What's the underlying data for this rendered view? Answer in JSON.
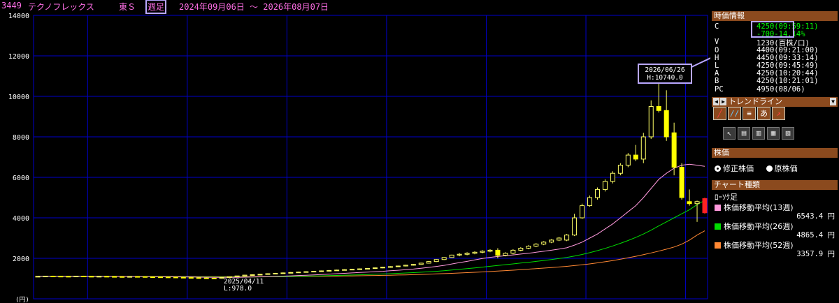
{
  "header": {
    "code": "3449",
    "name": "テクノフレックス",
    "market": "東Ｓ",
    "period": "週足",
    "range": "2024年09月06日 ～ 2026年08月07日"
  },
  "panel": {
    "price_info_title": "時価情報",
    "rows": [
      {
        "label": "C",
        "value": "4250",
        "extra": "(09:59:11)"
      },
      {
        "label": "",
        "value": "-700",
        "extra": "-14.14%"
      },
      {
        "label": "V",
        "value": "1230",
        "extra": "(百株/口)"
      },
      {
        "label": "O",
        "value": "4400",
        "extra": "(09:21:00)"
      },
      {
        "label": "H",
        "value": "4450",
        "extra": "(09:33:14)"
      },
      {
        "label": "L",
        "value": "4250",
        "extra": "(09:45:49)"
      },
      {
        "label": "A",
        "value": "4250",
        "extra": "(10:20:44)"
      },
      {
        "label": "B",
        "value": "4250",
        "extra": "(10:21:01)"
      },
      {
        "label": "PC",
        "value": "4950",
        "extra": "(08/06)"
      }
    ],
    "trendline_title": "トレンドライン",
    "stock_price_title": "株価",
    "radio_adjusted": "修正株価",
    "radio_original": "原株価",
    "chart_type_title": "チャート種類",
    "chart_type_value": "ﾛｰｿｸ足",
    "legend": [
      {
        "label": "株価移動平均(13週)",
        "value": "6543.4 円",
        "color": "#ff99dd"
      },
      {
        "label": "株価移動平均(26週)",
        "value": "4865.4 円",
        "color": "#00dd00"
      },
      {
        "label": "株価移動平均(52週)",
        "value": "3357.9 円",
        "color": "#ff8833"
      }
    ]
  },
  "chart_data": {
    "type": "candlestick",
    "ylim": [
      0,
      14000
    ],
    "yticks": [
      "0",
      "2000",
      "4000",
      "6000",
      "8000",
      "10000",
      "12000",
      "14000"
    ],
    "y_unit_label": "(円)",
    "colors": {
      "up": "#ffff00",
      "down_big": "#ffff00",
      "latest_down": "#ff2222",
      "grid": "#0000cc",
      "ma13": "#ff99dd",
      "ma26": "#00dd00",
      "ma52": "#ff8833"
    },
    "annotations": [
      {
        "date": "2026/06/26",
        "text": "H:10740.0",
        "value": 10740
      },
      {
        "date": "2025/04/11",
        "text": "L:978.0",
        "value": 978
      }
    ],
    "candles": [
      [
        1100,
        1120,
        1080,
        1110
      ],
      [
        1110,
        1130,
        1090,
        1120
      ],
      [
        1120,
        1140,
        1100,
        1115
      ],
      [
        1115,
        1130,
        1095,
        1110
      ],
      [
        1110,
        1125,
        1090,
        1105
      ],
      [
        1105,
        1130,
        1090,
        1120
      ],
      [
        1120,
        1140,
        1100,
        1110
      ],
      [
        1110,
        1120,
        1085,
        1100
      ],
      [
        1100,
        1120,
        1080,
        1110
      ],
      [
        1110,
        1130,
        1090,
        1100
      ],
      [
        1100,
        1115,
        1080,
        1095
      ],
      [
        1095,
        1110,
        1070,
        1090
      ],
      [
        1090,
        1110,
        1070,
        1100
      ],
      [
        1100,
        1120,
        1080,
        1095
      ],
      [
        1095,
        1110,
        1070,
        1085
      ],
      [
        1085,
        1100,
        1060,
        1080
      ],
      [
        1080,
        1100,
        1050,
        1075
      ],
      [
        1075,
        1090,
        1040,
        1070
      ],
      [
        1070,
        1085,
        1030,
        1060
      ],
      [
        1060,
        1080,
        1020,
        1050
      ],
      [
        1050,
        1070,
        1010,
        1040
      ],
      [
        1040,
        1060,
        1000,
        1030
      ],
      [
        1030,
        1050,
        990,
        1020
      ],
      [
        1020,
        1040,
        978,
        1010
      ],
      [
        1010,
        1060,
        990,
        1050
      ],
      [
        1050,
        1100,
        1030,
        1090
      ],
      [
        1090,
        1140,
        1070,
        1130
      ],
      [
        1130,
        1180,
        1110,
        1170
      ],
      [
        1170,
        1210,
        1150,
        1190
      ],
      [
        1190,
        1230,
        1170,
        1210
      ],
      [
        1210,
        1260,
        1190,
        1240
      ],
      [
        1240,
        1280,
        1220,
        1260
      ],
      [
        1260,
        1300,
        1240,
        1280
      ],
      [
        1280,
        1320,
        1260,
        1300
      ],
      [
        1300,
        1340,
        1280,
        1320
      ],
      [
        1320,
        1360,
        1300,
        1340
      ],
      [
        1340,
        1380,
        1320,
        1360
      ],
      [
        1360,
        1400,
        1340,
        1380
      ],
      [
        1380,
        1420,
        1360,
        1400
      ],
      [
        1400,
        1440,
        1380,
        1420
      ],
      [
        1420,
        1460,
        1400,
        1440
      ],
      [
        1440,
        1480,
        1420,
        1460
      ],
      [
        1460,
        1500,
        1440,
        1480
      ],
      [
        1480,
        1520,
        1460,
        1500
      ],
      [
        1500,
        1550,
        1480,
        1530
      ],
      [
        1530,
        1580,
        1510,
        1560
      ],
      [
        1560,
        1610,
        1540,
        1590
      ],
      [
        1590,
        1640,
        1570,
        1620
      ],
      [
        1620,
        1680,
        1600,
        1660
      ],
      [
        1660,
        1720,
        1640,
        1700
      ],
      [
        1700,
        1780,
        1680,
        1760
      ],
      [
        1760,
        1860,
        1740,
        1840
      ],
      [
        1840,
        1960,
        1820,
        1940
      ],
      [
        1940,
        2060,
        1920,
        2040
      ],
      [
        2040,
        2180,
        2020,
        2160
      ],
      [
        2160,
        2260,
        2100,
        2200
      ],
      [
        2200,
        2300,
        2150,
        2250
      ],
      [
        2250,
        2350,
        2200,
        2300
      ],
      [
        2300,
        2400,
        2250,
        2350
      ],
      [
        2350,
        2450,
        2300,
        2400
      ],
      [
        2400,
        2500,
        2000,
        2150
      ],
      [
        2150,
        2300,
        2100,
        2250
      ],
      [
        2250,
        2450,
        2200,
        2400
      ],
      [
        2400,
        2550,
        2350,
        2500
      ],
      [
        2500,
        2650,
        2450,
        2600
      ],
      [
        2600,
        2750,
        2550,
        2700
      ],
      [
        2700,
        2850,
        2650,
        2800
      ],
      [
        2800,
        2950,
        2750,
        2900
      ],
      [
        2900,
        3050,
        2850,
        3000
      ],
      [
        2900,
        3200,
        2850,
        3150
      ],
      [
        3150,
        4200,
        3100,
        4000
      ],
      [
        4000,
        4700,
        3950,
        4600
      ],
      [
        4600,
        5100,
        4550,
        5000
      ],
      [
        5000,
        5500,
        4900,
        5400
      ],
      [
        5400,
        5900,
        5300,
        5800
      ],
      [
        5800,
        6300,
        5700,
        6200
      ],
      [
        6200,
        6700,
        6100,
        6600
      ],
      [
        6600,
        7200,
        6500,
        7100
      ],
      [
        7100,
        7600,
        6800,
        6900
      ],
      [
        6900,
        8200,
        6700,
        8000
      ],
      [
        8000,
        9800,
        7900,
        9500
      ],
      [
        9500,
        10740,
        9200,
        9300
      ],
      [
        9300,
        10300,
        7800,
        8000
      ],
      [
        8200,
        8700,
        6100,
        6500
      ],
      [
        6500,
        6700,
        4900,
        5000
      ],
      [
        4800,
        5400,
        4600,
        4700
      ],
      [
        4700,
        4850,
        3800,
        4800
      ],
      [
        4950,
        5000,
        4200,
        4250
      ]
    ],
    "ma13": [
      1110,
      1110,
      1112,
      1112,
      1111,
      1110,
      1110,
      1108,
      1107,
      1106,
      1104,
      1102,
      1100,
      1099,
      1097,
      1094,
      1091,
      1088,
      1085,
      1080,
      1075,
      1070,
      1065,
      1060,
      1058,
      1058,
      1062,
      1068,
      1076,
      1085,
      1095,
      1108,
      1120,
      1135,
      1150,
      1165,
      1180,
      1200,
      1220,
      1240,
      1260,
      1280,
      1300,
      1320,
      1340,
      1360,
      1385,
      1410,
      1440,
      1470,
      1510,
      1550,
      1600,
      1650,
      1720,
      1790,
      1850,
      1920,
      1990,
      2050,
      2090,
      2130,
      2170,
      2210,
      2250,
      2300,
      2350,
      2400,
      2460,
      2520,
      2650,
      2800,
      3000,
      3200,
      3450,
      3700,
      4000,
      4300,
      4600,
      5000,
      5450,
      5900,
      6200,
      6450,
      6600,
      6650,
      6600,
      6543
    ],
    "ma26": [
      1110,
      1110,
      1110,
      1110,
      1110,
      1110,
      1110,
      1110,
      1110,
      1108,
      1106,
      1104,
      1102,
      1100,
      1098,
      1096,
      1094,
      1092,
      1090,
      1088,
      1086,
      1084,
      1082,
      1080,
      1078,
      1077,
      1077,
      1078,
      1080,
      1083,
      1087,
      1092,
      1098,
      1104,
      1110,
      1118,
      1126,
      1135,
      1145,
      1155,
      1165,
      1175,
      1187,
      1200,
      1213,
      1227,
      1242,
      1258,
      1275,
      1293,
      1313,
      1335,
      1360,
      1388,
      1420,
      1455,
      1490,
      1528,
      1566,
      1606,
      1645,
      1685,
      1725,
      1765,
      1805,
      1848,
      1893,
      1940,
      1990,
      2040,
      2110,
      2190,
      2280,
      2380,
      2490,
      2610,
      2740,
      2880,
      3030,
      3200,
      3390,
      3600,
      3800,
      4000,
      4200,
      4400,
      4650,
      4865
    ],
    "ma52": [
      1110,
      1110,
      1110,
      1110,
      1110,
      1110,
      1110,
      1110,
      1110,
      1110,
      1109,
      1108,
      1107,
      1106,
      1105,
      1104,
      1103,
      1102,
      1101,
      1100,
      1099,
      1098,
      1097,
      1096,
      1095,
      1094,
      1093,
      1093,
      1093,
      1094,
      1095,
      1097,
      1099,
      1101,
      1104,
      1107,
      1110,
      1114,
      1118,
      1122,
      1127,
      1132,
      1138,
      1144,
      1151,
      1158,
      1166,
      1175,
      1184,
      1194,
      1205,
      1217,
      1230,
      1244,
      1259,
      1275,
      1292,
      1310,
      1329,
      1349,
      1370,
      1392,
      1415,
      1439,
      1464,
      1490,
      1517,
      1545,
      1574,
      1604,
      1640,
      1680,
      1725,
      1775,
      1830,
      1890,
      1955,
      2025,
      2100,
      2180,
      2265,
      2355,
      2450,
      2560,
      2700,
      2900,
      3150,
      3357
    ]
  }
}
